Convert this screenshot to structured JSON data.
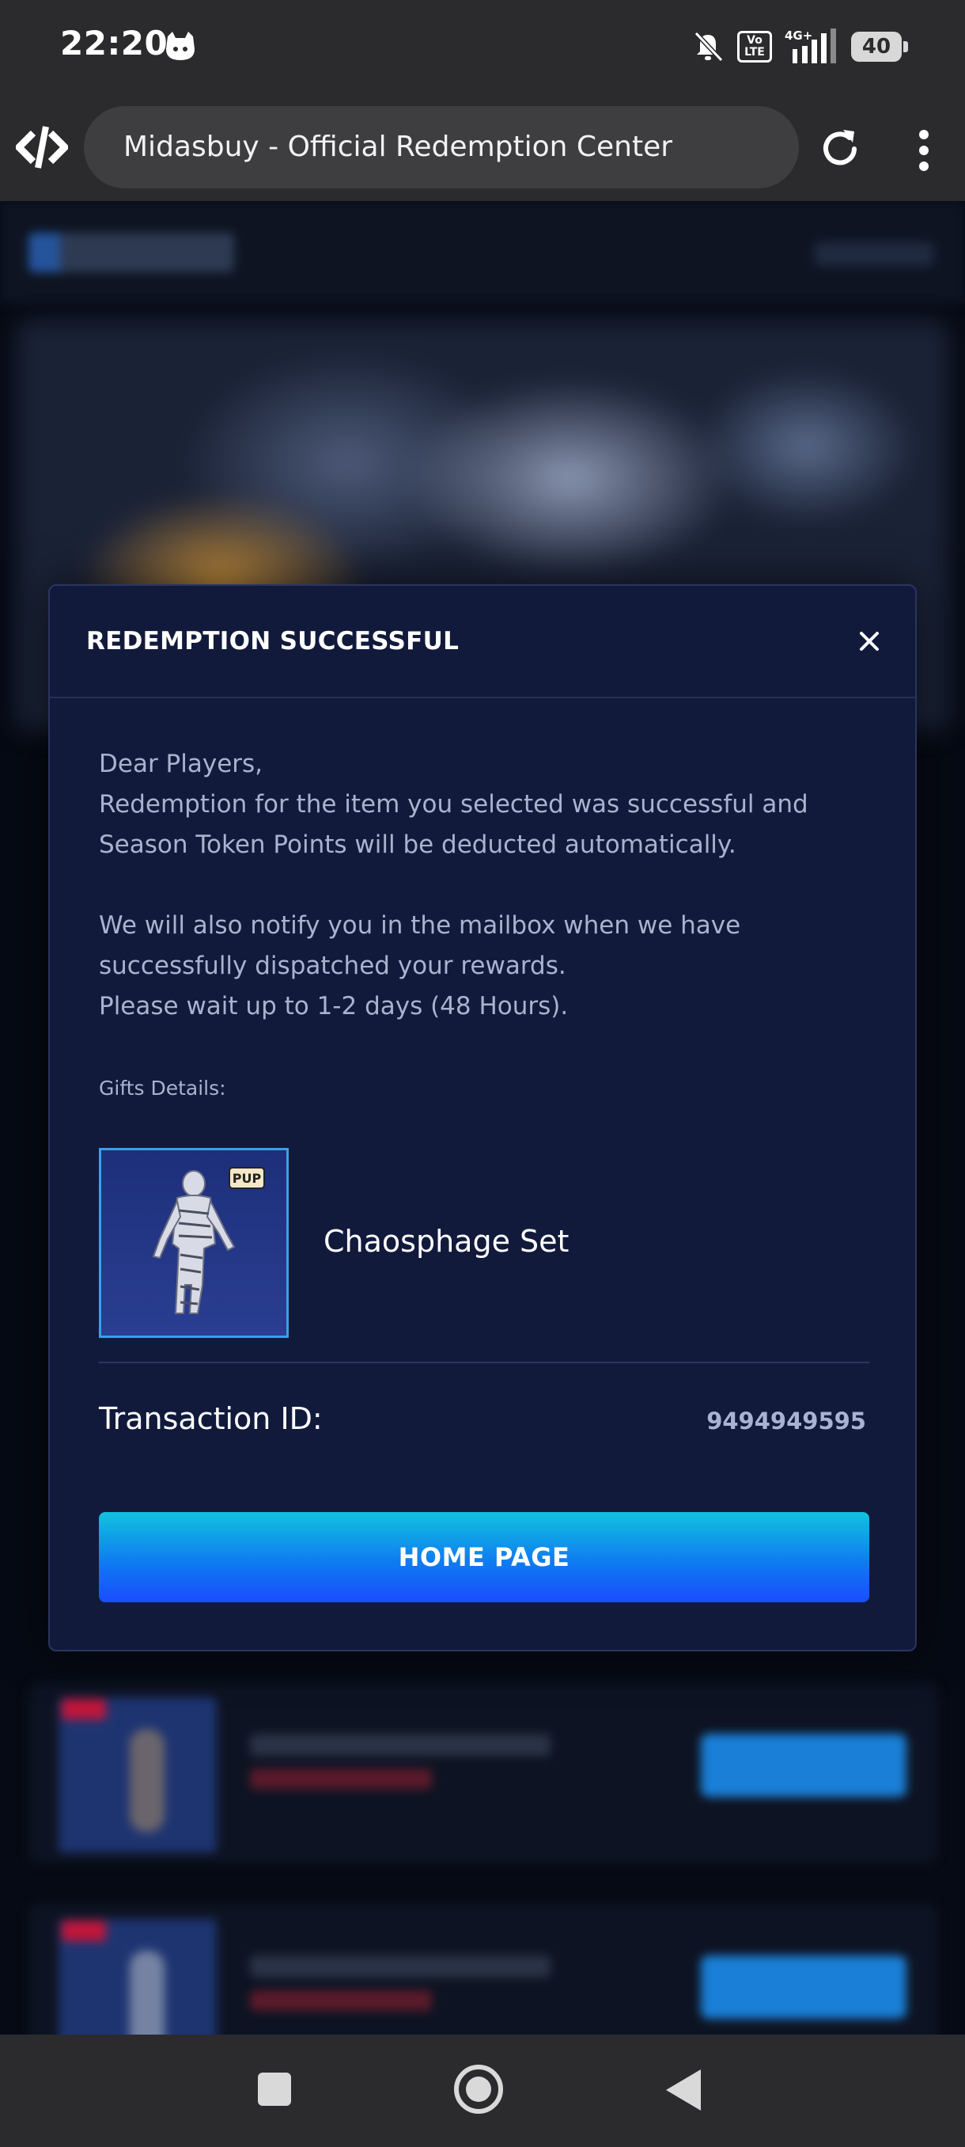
{
  "status_bar": {
    "time": "22:20",
    "network": "4G+",
    "volte": "Vo\nLTE",
    "battery": "40"
  },
  "browser": {
    "tab_title": "Midasbuy - Official Redemption Center"
  },
  "modal": {
    "title": "REDEMPTION SUCCESSFUL",
    "greeting": "Dear Players,",
    "paragraph1": "Redemption for the item you selected was successful and Season Token Points will be deducted automatically.",
    "paragraph2": "We will also notify you in the mailbox when we have successfully dispatched your rewards.",
    "paragraph3": "Please wait up to 1-2 days (48 Hours).",
    "gifts_label": "Gifts Details:",
    "gift": {
      "name": "Chaosphage Set",
      "badge": "PUP"
    },
    "transaction_label": "Transaction ID:",
    "transaction_id": "9494949595",
    "home_button": "HOME PAGE"
  },
  "icons": {
    "browser_logo": "code-brackets-icon",
    "reload": "reload-icon",
    "menu": "more-vertical-icon",
    "close": "close-icon",
    "mute": "bell-off-icon",
    "signal": "signal-icon",
    "battery": "battery-icon"
  },
  "colors": {
    "modal_bg": "#121a3c",
    "accent_gradient_top": "#12c2e0",
    "accent_gradient_bottom": "#1a4cff",
    "thumb_border": "#3aa0e8"
  }
}
